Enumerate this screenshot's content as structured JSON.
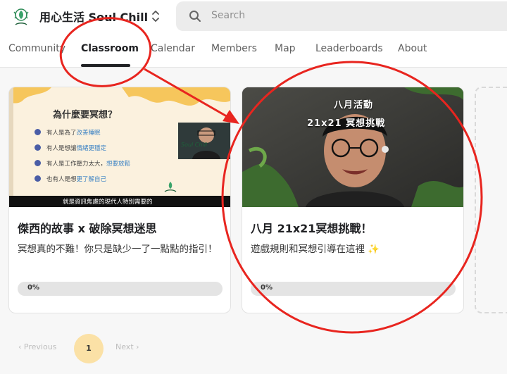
{
  "header": {
    "group_name": "用心生活 Soul Chill",
    "logo_icon": "soul-chill-logo",
    "switcher_icon": "chevron-updown-icon",
    "search": {
      "placeholder": "Search",
      "icon": "search-icon"
    }
  },
  "tabs": [
    {
      "label": "Community",
      "active": false
    },
    {
      "label": "Classroom",
      "active": true
    },
    {
      "label": "Calendar",
      "active": false
    },
    {
      "label": "Members",
      "active": false
    },
    {
      "label": "Map",
      "active": false
    },
    {
      "label": "Leaderboards",
      "active": false
    },
    {
      "label": "About",
      "active": false
    }
  ],
  "courses": [
    {
      "title": "傑西的故事 x 破除冥想迷思",
      "description": "冥想真的不難！你只是缺少一了一點點的指引！",
      "progress_label": "0%",
      "progress": 0,
      "thumbnail": {
        "slide_title": "為什麼要冥想？",
        "bullets": [
          {
            "pre": "有人是為了",
            "hl": "改善睡眠",
            "post": ""
          },
          {
            "pre": "有人是想讓",
            "hl": "情緒更穩定",
            "post": ""
          },
          {
            "pre": "有人是工作壓力太大，",
            "hl": "想要放鬆",
            "post": ""
          },
          {
            "pre": "也有人是想",
            "hl": "更了解自己",
            "post": ""
          }
        ],
        "subtitle": "就是資訊焦慮的現代人特別需要的",
        "webcam_label": "Soul Chill"
      }
    },
    {
      "title": "八月 21x21冥想挑戰！",
      "description": "遊戲規則和冥想引導在這裡 ✨",
      "progress_label": "0%",
      "progress": 0,
      "thumbnail": {
        "heading_line1": "八月活動",
        "heading_line2": "21x21 冥想挑戰"
      }
    }
  ],
  "pagination": {
    "prev_label": "Previous",
    "next_label": "Next",
    "current_page": "1"
  },
  "annotation": {
    "color": "#e8251f"
  }
}
